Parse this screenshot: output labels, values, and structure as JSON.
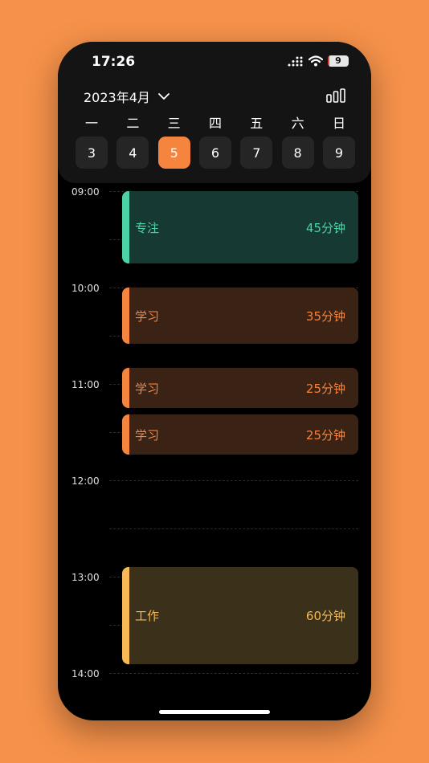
{
  "status": {
    "time": "17:26",
    "battery": "9"
  },
  "header": {
    "month": "2023年4月"
  },
  "week": {
    "days": [
      "一",
      "二",
      "三",
      "四",
      "五",
      "六",
      "日"
    ],
    "dates": [
      "3",
      "4",
      "5",
      "6",
      "7",
      "8",
      "9"
    ],
    "selected_index": 2
  },
  "timeline": {
    "hours": [
      "09:00",
      "10:00",
      "11:00",
      "12:00",
      "13:00",
      "14:00"
    ]
  },
  "events": [
    {
      "label": "专注",
      "duration": "45分钟"
    },
    {
      "label": "学习",
      "duration": "35分钟"
    },
    {
      "label": "学习",
      "duration": "25分钟"
    },
    {
      "label": "学习",
      "duration": "25分钟"
    },
    {
      "label": "工作",
      "duration": "60分钟"
    }
  ],
  "colors": {
    "background": "#F5914A",
    "accent": "#F5843F",
    "focus": "#4CD3A5",
    "study": "#F5843F",
    "work": "#F7B955"
  }
}
